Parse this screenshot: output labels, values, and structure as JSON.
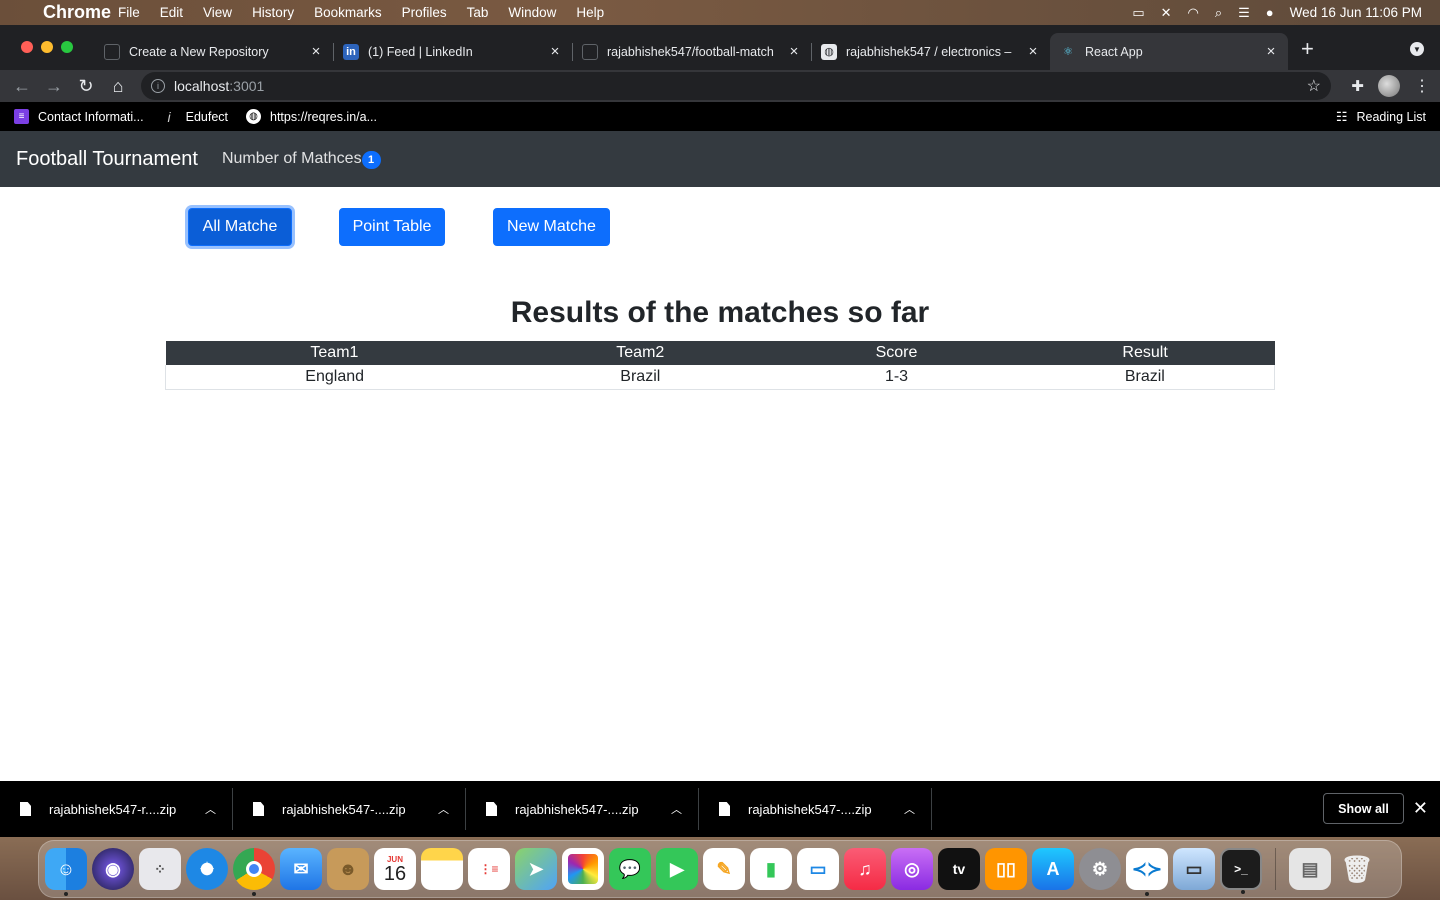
{
  "menubar": {
    "items": [
      "Chrome",
      "File",
      "Edit",
      "View",
      "History",
      "Bookmarks",
      "Profiles",
      "Tab",
      "Window",
      "Help"
    ],
    "datetime": "Wed 16 Jun  11:06 PM"
  },
  "tabs": [
    {
      "title": "Create a New Repository",
      "icon": "github-icon"
    },
    {
      "title": "(1) Feed | LinkedIn",
      "icon": "linkedin-icon"
    },
    {
      "title": "rajabhishek547/football-match",
      "icon": "github-icon"
    },
    {
      "title": "rajabhishek547 / electronics –",
      "icon": "globe-icon"
    },
    {
      "title": "React App",
      "icon": "react-icon"
    }
  ],
  "address": {
    "host": "localhost",
    "port": ":3001"
  },
  "bookmarks": [
    {
      "label": "Contact Informati...",
      "icon": "list-icon"
    },
    {
      "label": "Edufect",
      "icon": "info-icon"
    },
    {
      "label": "https://reqres.in/a...",
      "icon": "globe-icon"
    }
  ],
  "reading_list": "Reading List",
  "app": {
    "brand": "Football Tournament",
    "matches_link": "Number of Mathces",
    "match_count": "1",
    "buttons": {
      "all": "All Matche",
      "points": "Point Table",
      "new": "New Matche"
    },
    "results_title": "Results of the matches so far",
    "table": {
      "headers": [
        "Team1",
        "Team2",
        "Score",
        "Result"
      ],
      "rows": [
        [
          "England",
          "Brazil",
          "1-3",
          "Brazil"
        ]
      ]
    }
  },
  "downloads": {
    "items": [
      "rajabhishek547-r....zip",
      "rajabhishek547-....zip",
      "rajabhishek547-....zip",
      "rajabhishek547-....zip"
    ],
    "show_all": "Show all"
  },
  "dock": {
    "apps": [
      "finder",
      "siri",
      "launchpad",
      "safari",
      "chrome",
      "mail",
      "contacts",
      "calendar",
      "notes",
      "reminders",
      "maps",
      "photos",
      "messages",
      "facetime",
      "pages",
      "numbers",
      "keynote",
      "music",
      "podcasts",
      "tv",
      "books",
      "app-store",
      "system-preferences",
      "vscode",
      "preview",
      "terminal",
      "downloads-stack",
      "trash"
    ],
    "calendar_month": "JUN",
    "calendar_day": "16",
    "tv_label": "tv"
  }
}
